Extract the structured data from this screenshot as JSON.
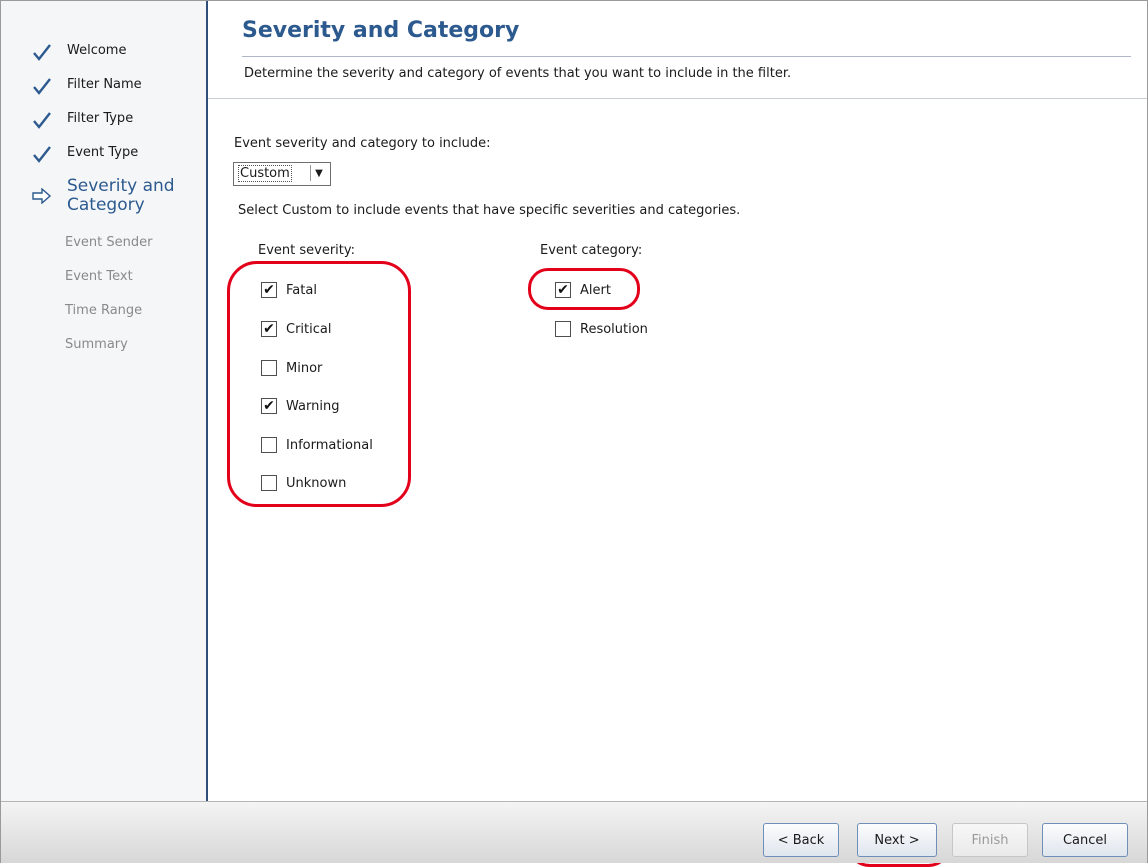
{
  "steps": [
    {
      "label": "Welcome",
      "status": "done"
    },
    {
      "label": "Filter Name",
      "status": "done"
    },
    {
      "label": "Filter Type",
      "status": "done"
    },
    {
      "label": "Event Type",
      "status": "done"
    },
    {
      "label_line1": "Severity and",
      "label_line2": "Category",
      "status": "current"
    },
    {
      "label": "Event Sender",
      "status": "pending"
    },
    {
      "label": "Event Text",
      "status": "pending"
    },
    {
      "label": "Time Range",
      "status": "pending"
    },
    {
      "label": "Summary",
      "status": "pending"
    }
  ],
  "header": {
    "title": "Severity and Category",
    "description": "Determine the severity and category of events that you want to include in the filter."
  },
  "body": {
    "include_label": "Event severity and category to include:",
    "dropdown_value": "Custom",
    "hint": "Select Custom to include events that have specific severities and categories.",
    "severity_heading": "Event severity:",
    "category_heading": "Event category:",
    "severities": [
      {
        "label": "Fatal",
        "checked": true
      },
      {
        "label": "Critical",
        "checked": true
      },
      {
        "label": "Minor",
        "checked": false
      },
      {
        "label": "Warning",
        "checked": true
      },
      {
        "label": "Informational",
        "checked": false
      },
      {
        "label": "Unknown",
        "checked": false
      }
    ],
    "categories": [
      {
        "label": "Alert",
        "checked": true
      },
      {
        "label": "Resolution",
        "checked": false
      }
    ]
  },
  "buttons": {
    "back": "< Back",
    "next": "Next >",
    "finish": "Finish",
    "cancel": "Cancel"
  },
  "colors": {
    "accent": "#2c5a8f",
    "highlight": "#e3001b"
  }
}
